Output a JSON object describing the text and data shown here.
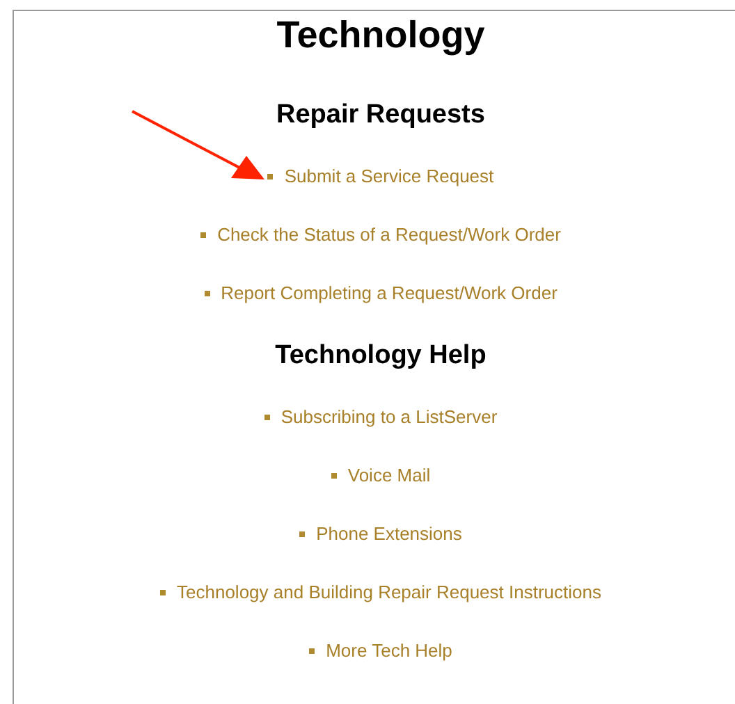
{
  "page": {
    "title": "Technology"
  },
  "sections": [
    {
      "heading": "Repair Requests",
      "links": [
        "Submit a Service Request",
        "Check the Status of a Request/Work Order",
        "Report Completing a Request/Work Order"
      ]
    },
    {
      "heading": "Technology Help",
      "links": [
        "Subscribing to a ListServer",
        "Voice Mail",
        "Phone Extensions",
        "Technology and Building Repair Request Instructions",
        "More Tech Help"
      ]
    }
  ]
}
